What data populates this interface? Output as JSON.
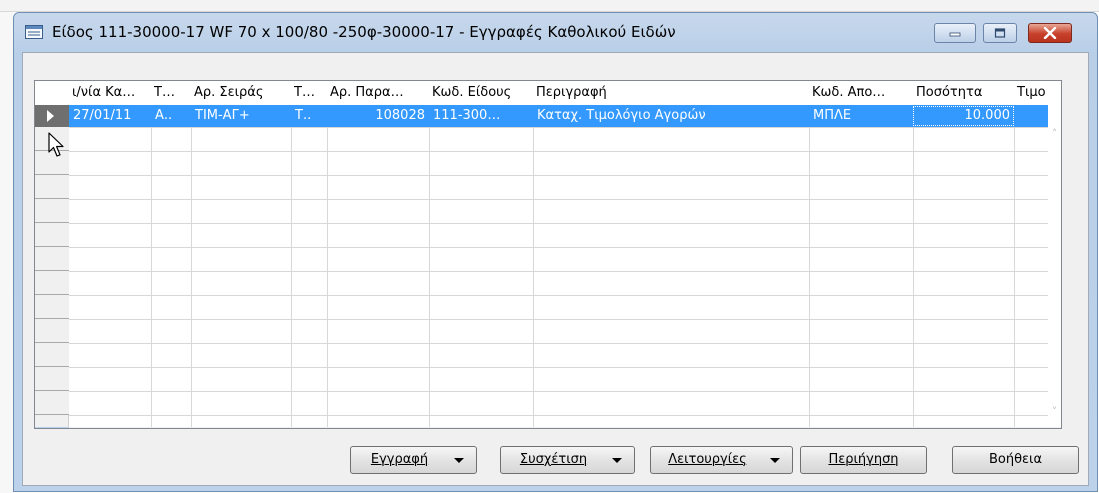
{
  "window": {
    "title": "Είδος 111-30000-17 WF 70 x 100/80 -250φ-30000-17 - Εγγραφές Καθολικού Ειδών",
    "controls": {
      "minimize": "minimize",
      "maximize": "maximize",
      "close": "close"
    }
  },
  "grid": {
    "columns": [
      "ι/νία Κα…",
      "Τ…",
      "Αρ. Σειράς",
      "Τ…",
      "Αρ. Παρα…",
      "Κωδ. Είδους",
      "Περιγραφή",
      "Κωδ. Απο…",
      "Ποσότητα",
      "Τιμο"
    ],
    "rows": [
      [
        "27/01/11",
        "Α..",
        "ΤΙΜ-ΑΓ+",
        "Τ..",
        "108028",
        "111-300…",
        "Καταχ. Τιμολόγιο Αγορών",
        "ΜΠΛΕ",
        "10.000",
        ""
      ]
    ],
    "selected_row": 0,
    "horizontal_scroll": {
      "left": "‹",
      "right": "›"
    },
    "vertical_scroll": {
      "up": "˄",
      "down": "˅"
    }
  },
  "buttons": {
    "entry": "Εγγραφή",
    "correlation": "Συσχέτιση",
    "functions": "Λειτουργίες",
    "navigate": "Περιήγηση",
    "help": "Βοήθεια"
  },
  "colors": {
    "selection": "#3399ff",
    "titlebar": "#b9cfe8",
    "close_button": "#c7402a"
  }
}
